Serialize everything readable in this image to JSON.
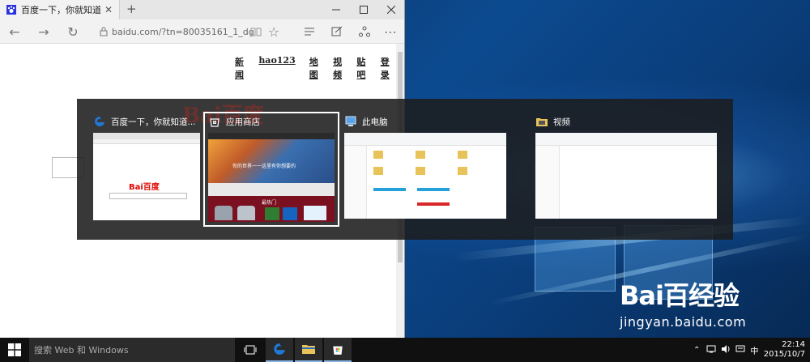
{
  "browser": {
    "tab_title": "百度一下，你就知道",
    "tab_close": "✕",
    "new_tab": "+",
    "address": "baidu.com/?tn=80035161_1_dg",
    "nav_links": [
      "新闻",
      "hao123",
      "地图",
      "视频",
      "贴吧",
      "登录"
    ]
  },
  "switcher": {
    "bg_logo": "Bai百度",
    "cards": [
      {
        "title": "百度一下，你就知道..."
      },
      {
        "title": "应用商店"
      },
      {
        "title": "此电脑"
      },
      {
        "title": "视频"
      }
    ],
    "baidu_thumb_logo": "Bai百度",
    "store_thumb_text": "你的世界一一这里有你想要的",
    "store_section": "最热门"
  },
  "taskbar": {
    "search_placeholder": "搜索 Web 和 Windows",
    "ime": "中",
    "time": "22:14",
    "date": "2015/10/7"
  },
  "watermark": {
    "line1": "Bai百经验",
    "line2": "jingyan.baidu.com"
  },
  "colors": {
    "baidu_red": "#e10601",
    "baidu_blue": "#2932e1",
    "edge_blue": "#1e7ad6",
    "taskbar": "#101010"
  }
}
